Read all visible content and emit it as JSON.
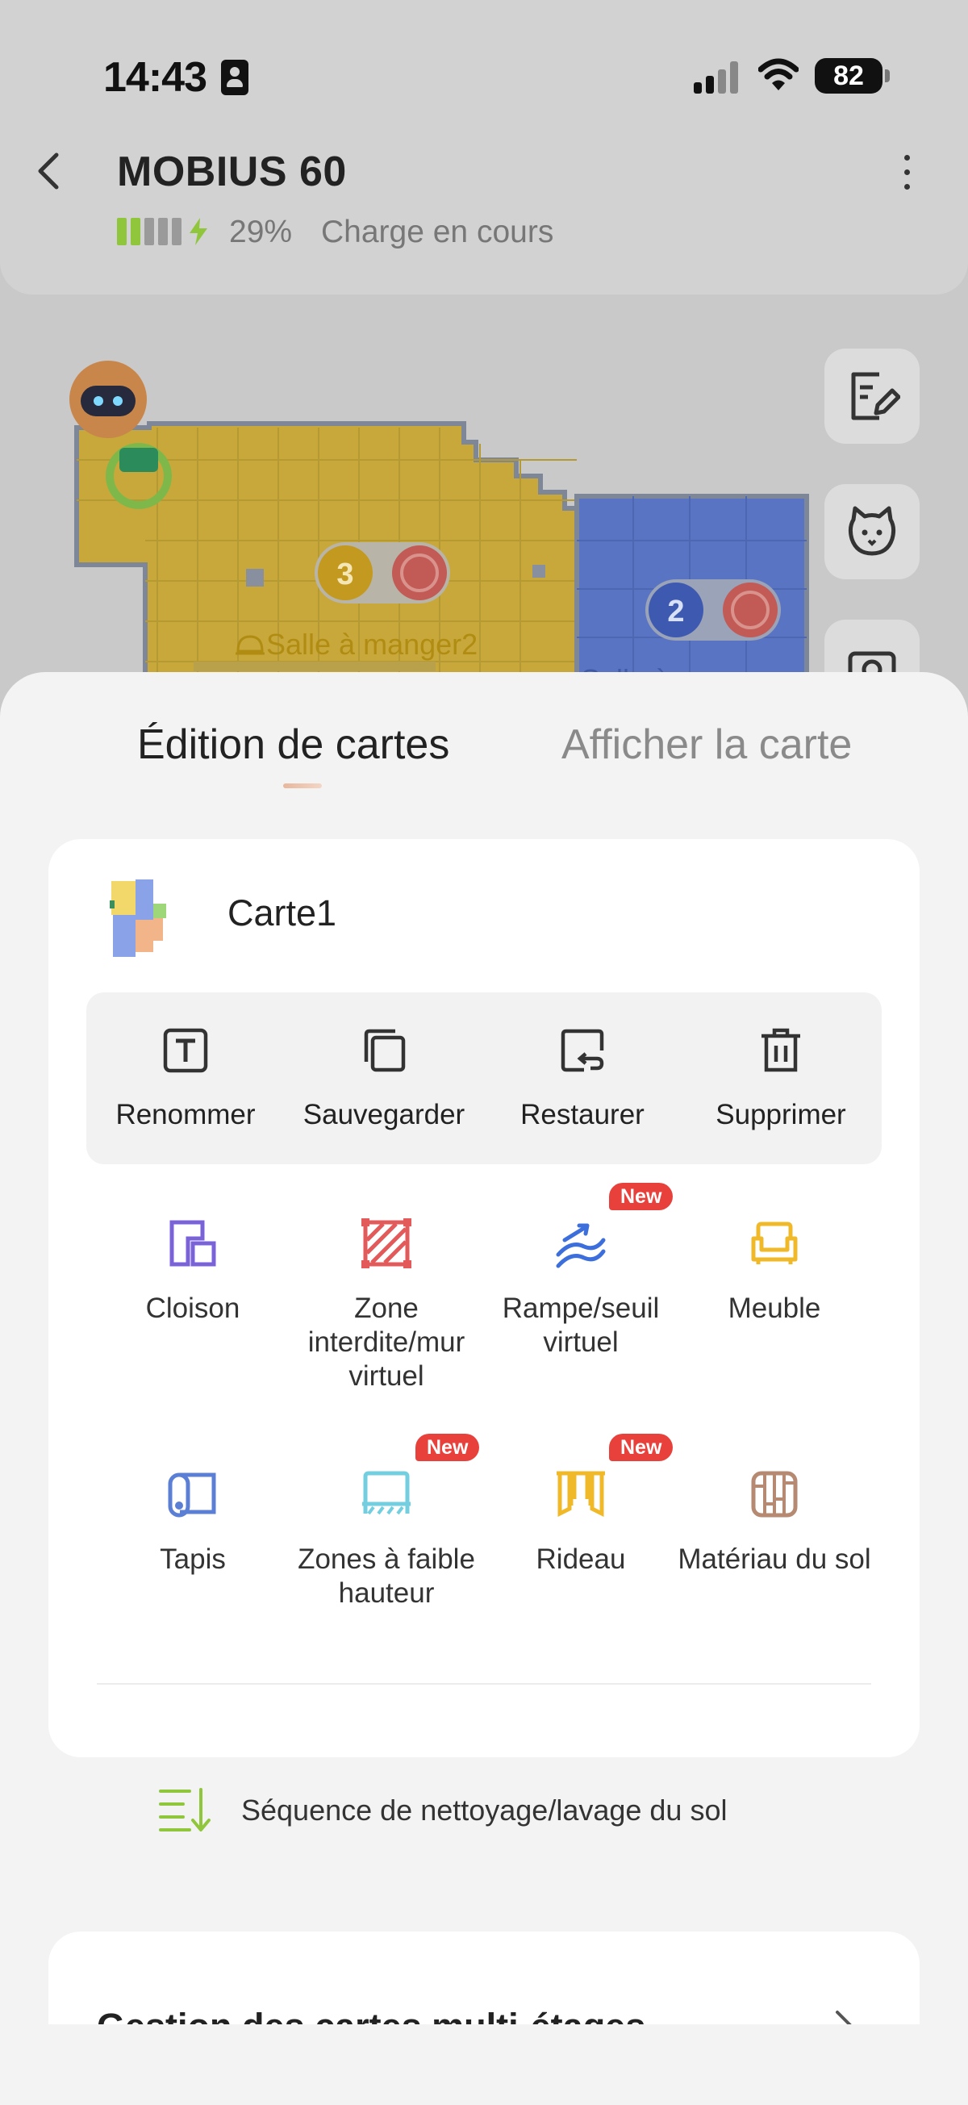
{
  "status_bar": {
    "time": "14:43",
    "battery": "82"
  },
  "header": {
    "device_name": "MOBIUS 60",
    "charge_percent": "29%",
    "charge_status": "Charge en cours"
  },
  "map": {
    "room_label": "Salle à manger2",
    "room_label_2": "Salle à",
    "room_numbers": [
      "3",
      "2"
    ]
  },
  "tabs": {
    "active": "Édition de cartes",
    "inactive": "Afficher la carte"
  },
  "card": {
    "map_name": "Carte1",
    "actions": [
      {
        "label": "Renommer",
        "icon": "rename-icon"
      },
      {
        "label": "Sauvegarder",
        "icon": "copy-icon"
      },
      {
        "label": "Restaurer",
        "icon": "restore-icon"
      },
      {
        "label": "Supprimer",
        "icon": "trash-icon"
      }
    ],
    "tools": [
      {
        "label": "Cloison",
        "icon": "partition-icon",
        "color": "#7a63d8",
        "new": false
      },
      {
        "label": "Zone interdite/mur virtuel",
        "icon": "no-go-zone-icon",
        "color": "#e25a5a",
        "new": false
      },
      {
        "label": "Rampe/seuil virtuel",
        "icon": "ramp-icon",
        "color": "#3c6fdc",
        "new": true
      },
      {
        "label": "Meuble",
        "icon": "furniture-icon",
        "color": "#f0b92a",
        "new": false
      },
      {
        "label": "Tapis",
        "icon": "carpet-icon",
        "color": "#5b7fd4",
        "new": false
      },
      {
        "label": "Zones à faible hauteur",
        "icon": "low-height-icon",
        "color": "#73cfe0",
        "new": true
      },
      {
        "label": "Rideau",
        "icon": "curtain-icon",
        "color": "#f0b92a",
        "new": true
      },
      {
        "label": "Matériau du sol",
        "icon": "floor-material-icon",
        "color": "#b68a72",
        "new": false
      }
    ],
    "new_badge": "New",
    "sequence_label": "Séquence de nettoyage/lavage du sol"
  },
  "multi_floor": {
    "title": "Gestion des cartes multi-étages"
  },
  "colors": {
    "accent_green": "#8fc63c",
    "new_badge": "#e8413b",
    "room_yellow": "#c8a83a",
    "room_blue": "#5a74c4"
  }
}
